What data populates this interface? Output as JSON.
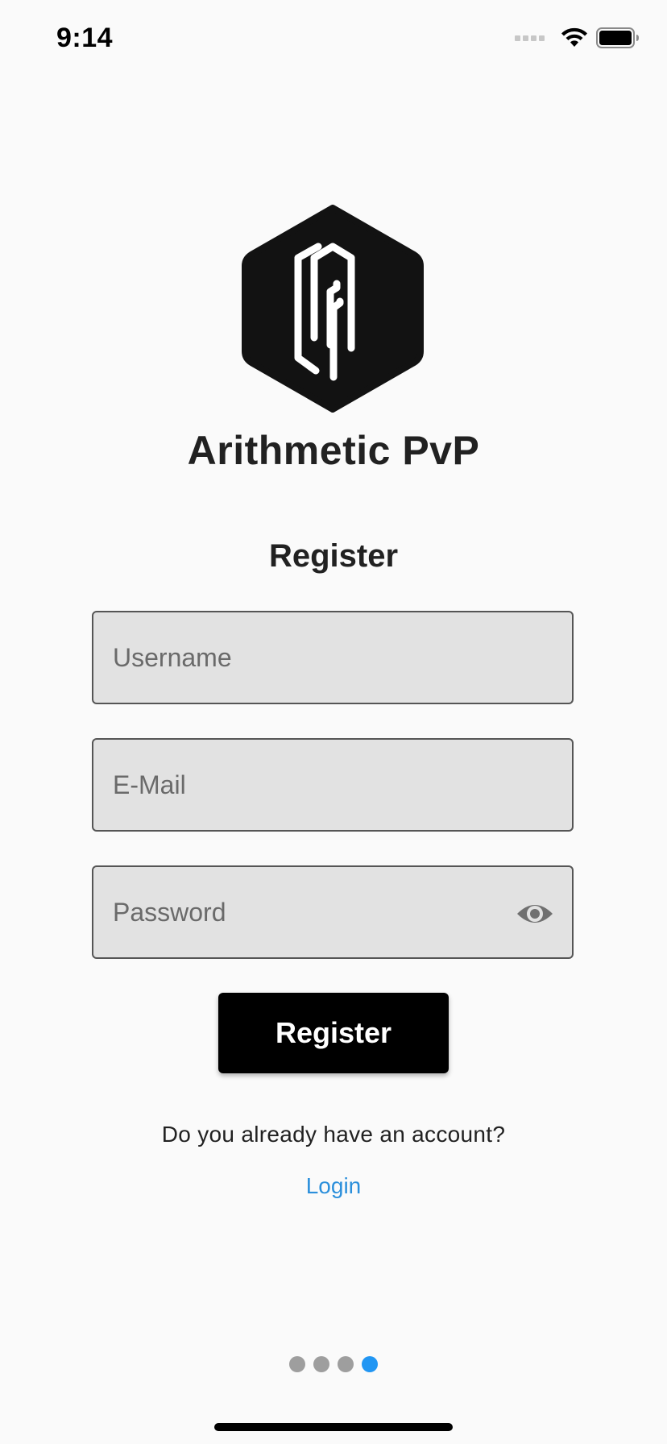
{
  "status_bar": {
    "time": "9:14",
    "icons": [
      "cellular-icon",
      "wifi-icon",
      "battery-icon"
    ]
  },
  "app": {
    "logo_icon": "arithmetic-pvp-logo-icon",
    "title": "Arithmetic PvP"
  },
  "form": {
    "heading": "Register",
    "username_placeholder": "Username",
    "username_value": "",
    "email_placeholder": "E-Mail",
    "email_value": "",
    "password_placeholder": "Password",
    "password_value": "",
    "password_toggle_icon": "eye-icon",
    "submit_label": "Register"
  },
  "footer": {
    "question": "Do you already have an account?",
    "login_label": "Login"
  },
  "page_indicator": {
    "count": 4,
    "active_index": 3
  },
  "colors": {
    "background": "#fafafa",
    "field_fill": "#e2e2e2",
    "button": "#000000",
    "link": "#2b8fdb",
    "active_dot": "#2196f3",
    "inactive_dot": "#9e9e9e"
  }
}
